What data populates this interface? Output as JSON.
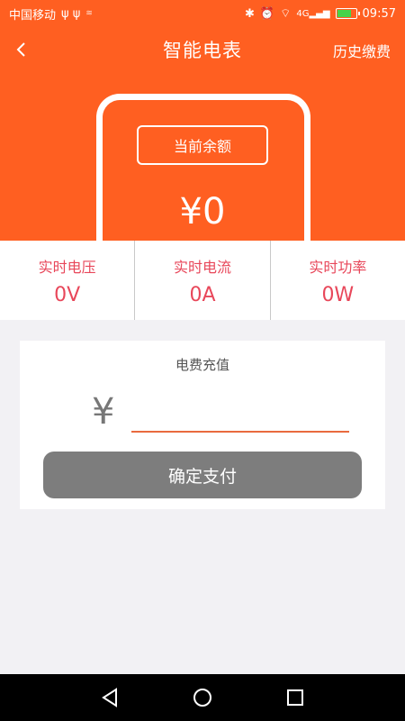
{
  "status_bar": {
    "carrier": "中国移动",
    "time": "09:57",
    "signal_text": "4G"
  },
  "header": {
    "title": "智能电表",
    "history_label": "历史缴费"
  },
  "balance": {
    "label": "当前余额",
    "value": "¥0"
  },
  "metrics": [
    {
      "label": "实时电压",
      "value": "0V"
    },
    {
      "label": "实时电流",
      "value": "0A"
    },
    {
      "label": "实时功率",
      "value": "0W"
    }
  ],
  "recharge": {
    "title": "电费充值",
    "currency_symbol": "¥",
    "input_value": "",
    "pay_label": "确定支付"
  },
  "colors": {
    "brand": "#ff5f21",
    "metric_text": "#e8475a",
    "pay_button": "#7d7d7d"
  }
}
